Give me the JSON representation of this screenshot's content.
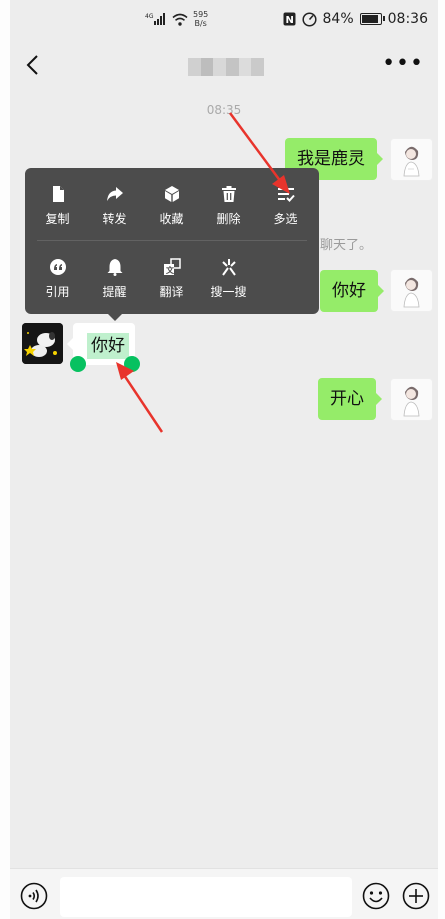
{
  "status_bar": {
    "signal_label": "4G",
    "net_speed_value": "595",
    "net_speed_unit": "B/s",
    "nfc_label": "N",
    "battery_percent": "84%",
    "battery_level": 0.84,
    "time": "08:36"
  },
  "header": {
    "back_icon": "chevron-left-icon",
    "more_icon": "more-dots-icon",
    "more_label": "•••"
  },
  "chat": {
    "timestamp": "08:35",
    "messages": [
      {
        "side": "me",
        "text": "我是鹿灵"
      },
      {
        "side": "system",
        "text": "聊天了。"
      },
      {
        "side": "me",
        "text": "你好"
      },
      {
        "side": "other",
        "text": "你好",
        "selected": true
      },
      {
        "side": "me",
        "text": "开心"
      }
    ]
  },
  "context_menu": {
    "row1": [
      {
        "label": "复制",
        "icon": "copy-icon"
      },
      {
        "label": "转发",
        "icon": "forward-icon"
      },
      {
        "label": "收藏",
        "icon": "favorite-cube-icon"
      },
      {
        "label": "删除",
        "icon": "trash-icon"
      },
      {
        "label": "多选",
        "icon": "multi-select-icon"
      }
    ],
    "row2": [
      {
        "label": "引用",
        "icon": "quote-icon"
      },
      {
        "label": "提醒",
        "icon": "bell-icon"
      },
      {
        "label": "翻译",
        "icon": "translate-icon"
      },
      {
        "label": "搜一搜",
        "icon": "search-sparkle-icon"
      }
    ]
  },
  "input_bar": {
    "voice_icon": "voice-icon",
    "emoji_icon": "emoji-icon",
    "plus_icon": "plus-circle-icon",
    "message_value": ""
  },
  "colors": {
    "my_bubble": "#95ec69",
    "selection_handle": "#07c160",
    "menu_background": "#4c4c4c",
    "annotation_arrow": "#e8342c"
  }
}
